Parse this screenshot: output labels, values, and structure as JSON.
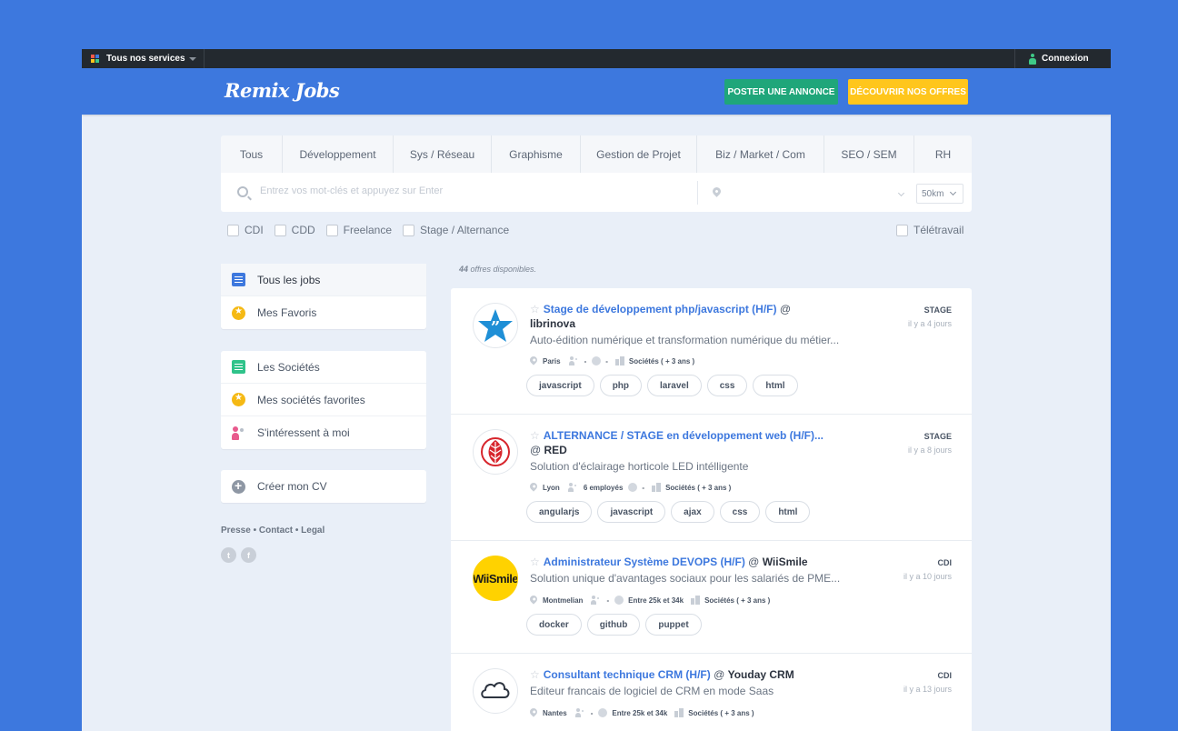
{
  "topbar": {
    "services_label": "Tous nos services",
    "login_label": "Connexion"
  },
  "header": {
    "logo": "Remix Jobs",
    "post_button": "POSTER UNE ANNONCE",
    "offers_button": "DÉCOUVRIR NOS OFFRES"
  },
  "categories": [
    "Tous",
    "Développement",
    "Sys / Réseau",
    "Graphisme",
    "Gestion de Projet",
    "Biz / Market / Com",
    "SEO / SEM",
    "RH"
  ],
  "search": {
    "placeholder": "Entrez vos mot-clés et appuyez sur Enter",
    "radius": "50km"
  },
  "contract_filters": [
    "CDI",
    "CDD",
    "Freelance",
    "Stage / Alternance"
  ],
  "remote_filter": "Télétravail",
  "sidebar": {
    "group1": [
      "Tous les jobs",
      "Mes Favoris"
    ],
    "group2": [
      "Les Sociétés",
      "Mes sociétés favorites",
      "S'intéressent à moi"
    ],
    "group3": [
      "Créer mon CV"
    ],
    "footer_links": "Presse • Contact • Legal",
    "social": [
      "t",
      "f"
    ]
  },
  "results": {
    "count": "44",
    "count_label": " offres disponibles."
  },
  "jobs": [
    {
      "title": "Stage de développement php/javascript (H/F)",
      "company": "librinova",
      "description": "Auto-édition numérique et transformation numérique du métier...",
      "city": "Paris",
      "staff": "-",
      "salary": "-",
      "companies": "Sociétés ( + 3 ans )",
      "type": "STAGE",
      "ago": "il y a 4 jours",
      "tags": [
        "javascript",
        "php",
        "laravel",
        "css",
        "html"
      ]
    },
    {
      "title": "ALTERNANCE / STAGE en développement web (H/F)...",
      "company": "RED",
      "description": "Solution d'éclairage horticole LED intélligente",
      "city": "Lyon",
      "staff": "6 employés",
      "salary": "-",
      "companies": "Sociétés ( + 3 ans )",
      "type": "STAGE",
      "ago": "il y a 8 jours",
      "tags": [
        "angularjs",
        "javascript",
        "ajax",
        "css",
        "html"
      ]
    },
    {
      "title": "Administrateur Système DEVOPS (H/F)",
      "company": "WiiSmile",
      "description": "Solution unique d'avantages sociaux pour les salariés de PME...",
      "city": "Montmelian",
      "staff": "-",
      "salary": "Entre 25k et 34k",
      "companies": "Sociétés ( + 3 ans )",
      "type": "CDI",
      "ago": "il y a 10 jours",
      "tags": [
        "docker",
        "github",
        "puppet"
      ]
    },
    {
      "title": "Consultant technique CRM (H/F)",
      "company": "Youday CRM",
      "description": "Editeur francais de logiciel de CRM en mode Saas",
      "city": "Nantes",
      "staff": "-",
      "salary": "Entre 25k et 34k",
      "companies": "Sociétés ( + 3 ans )",
      "type": "CDI",
      "ago": "il y a 13 jours",
      "tags": []
    }
  ],
  "logos": {
    "wiismile_text": "WiiSmile"
  },
  "colors": {
    "brand_blue": "#3d78de",
    "post_green": "#1fa67a",
    "offers_yellow": "#ffc61c",
    "topbar": "#23292f"
  }
}
